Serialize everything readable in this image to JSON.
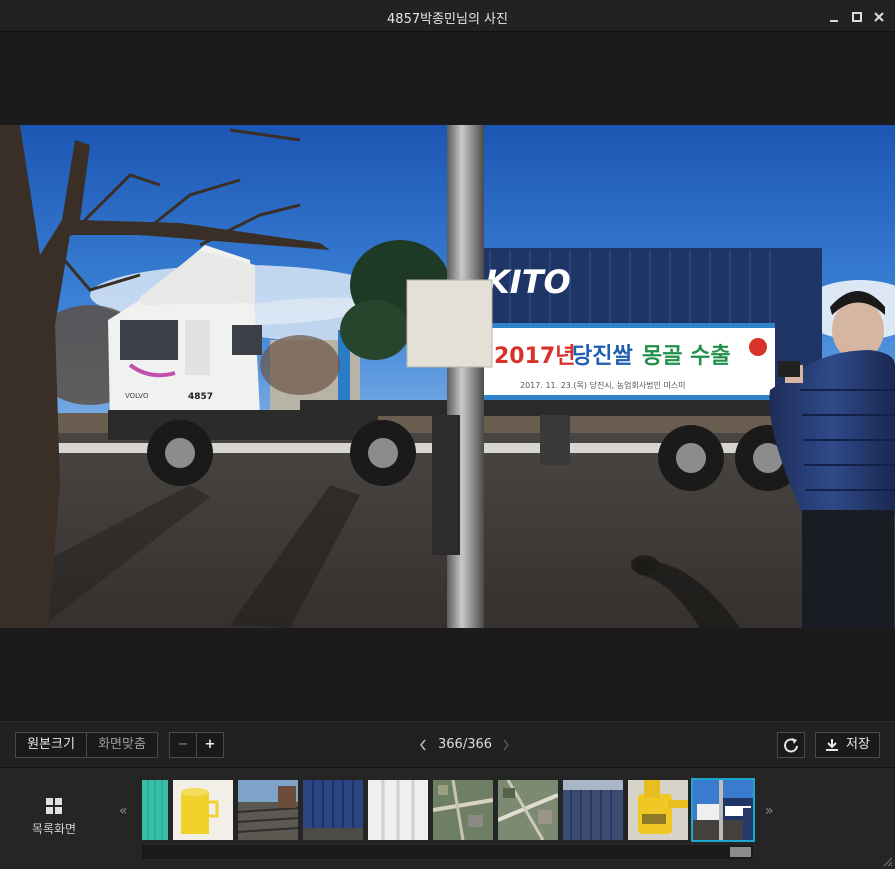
{
  "window": {
    "title": "4857박종민님의 사진"
  },
  "photo": {
    "truck_number": "4857",
    "truck_brand": "VOLVO",
    "container_text": "KITO",
    "banner_title_red": "2017년",
    "banner_title_blue": "당진쌀",
    "banner_title_green": "몽골 수출",
    "banner_subtitle": "2017. 11. 23.(목)    당진시, 농업회사법인 미스미"
  },
  "toolbar": {
    "original_size_label": "원본크기",
    "fit_screen_label": "화면맞춤",
    "zoom_out_label": "−",
    "zoom_in_label": "+",
    "page_counter": "366/366",
    "save_label": "저장"
  },
  "strip": {
    "list_view_label": "목록화면",
    "prev_label": "«",
    "next_label": "»",
    "scroll_position": 0.97
  }
}
